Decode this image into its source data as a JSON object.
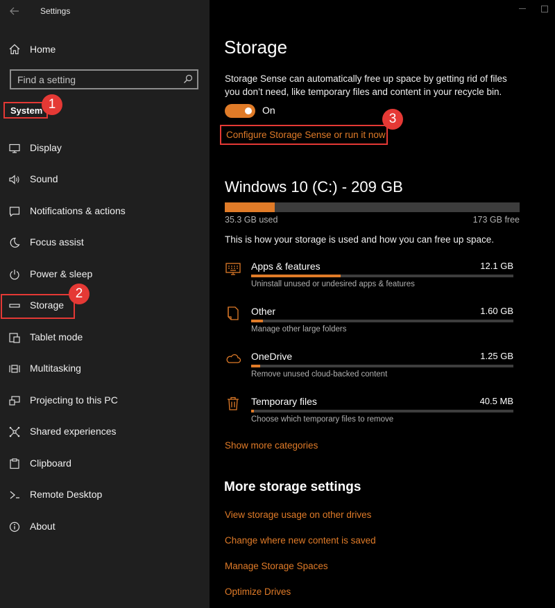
{
  "window": {
    "title": "Settings"
  },
  "sidebar": {
    "home_label": "Home",
    "search_placeholder": "Find a setting",
    "section_label": "System",
    "items": [
      {
        "label": "Display",
        "icon": "display-icon"
      },
      {
        "label": "Sound",
        "icon": "sound-icon"
      },
      {
        "label": "Notifications & actions",
        "icon": "notifications-icon"
      },
      {
        "label": "Focus assist",
        "icon": "moon-icon"
      },
      {
        "label": "Power & sleep",
        "icon": "power-icon"
      },
      {
        "label": "Storage",
        "icon": "storage-icon"
      },
      {
        "label": "Tablet mode",
        "icon": "tablet-icon"
      },
      {
        "label": "Multitasking",
        "icon": "multitasking-icon"
      },
      {
        "label": "Projecting to this PC",
        "icon": "projecting-icon"
      },
      {
        "label": "Shared experiences",
        "icon": "shared-icon"
      },
      {
        "label": "Clipboard",
        "icon": "clipboard-icon"
      },
      {
        "label": "Remote Desktop",
        "icon": "remote-desktop-icon"
      },
      {
        "label": "About",
        "icon": "info-icon"
      }
    ]
  },
  "annotations": {
    "badge1": "1",
    "badge2": "2",
    "badge3": "3"
  },
  "main": {
    "title": "Storage",
    "sense_description": "Storage Sense can automatically free up space by getting rid of files you don’t need, like temporary files and content in your recycle bin.",
    "toggle_state": "On",
    "configure_link": "Configure Storage Sense or run it now",
    "drive": {
      "title": "Windows 10 (C:) - 209 GB",
      "used": "35.3 GB used",
      "free": "173 GB free",
      "used_fraction": 0.169
    },
    "usage_description": "This is how your storage is used and how you can free up space.",
    "categories": [
      {
        "name": "Apps & features",
        "size": "12.1 GB",
        "sub": "Uninstall unused or undesired apps & features",
        "fraction": 0.34,
        "icon": "apps-features-icon"
      },
      {
        "name": "Other",
        "size": "1.60 GB",
        "sub": "Manage other large folders",
        "fraction": 0.045,
        "icon": "other-folder-icon"
      },
      {
        "name": "OneDrive",
        "size": "1.25 GB",
        "sub": "Remove unused cloud-backed content",
        "fraction": 0.035,
        "icon": "cloud-icon"
      },
      {
        "name": "Temporary files",
        "size": "40.5 MB",
        "sub": "Choose which temporary files to remove",
        "fraction": 0.005,
        "icon": "trash-icon"
      }
    ],
    "show_more": "Show more categories",
    "more_title": "More storage settings",
    "more_links": [
      "View storage usage on other drives",
      "Change where new content is saved",
      "Manage Storage Spaces",
      "Optimize Drives"
    ]
  },
  "colors": {
    "accent": "#e07b28",
    "annotation": "#e53935",
    "sidebar_bg": "#1f1f1f",
    "main_bg": "#000000"
  }
}
